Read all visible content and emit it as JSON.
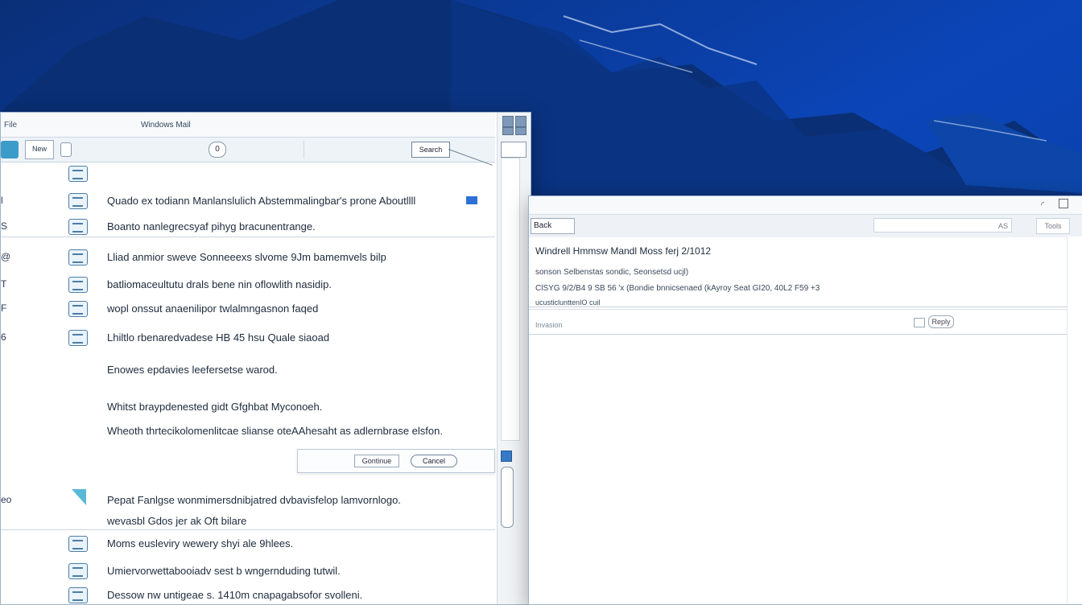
{
  "left_window": {
    "title_left": "File",
    "title_center": "Windows Mail",
    "toolbar": {
      "new_label": "New",
      "search_label": "0",
      "action_label": "Search"
    },
    "rows": [
      {
        "left": "",
        "text": ""
      },
      {
        "left": "l",
        "text": "Quado ex todiann Manlanslulich Abstemmalingbar's prone Aboutllll"
      },
      {
        "left": "S",
        "text": "Boanto nanlegrecsyaf pihyg bracunentrange."
      },
      {
        "left": "@",
        "text": "Lliad anmior sweve Sonneeexs slvome 9Jm bamemvels bilp"
      },
      {
        "left": "T",
        "text": "batliomaceultutu drals bene nin oflowlith nasidip."
      },
      {
        "left": "F",
        "text": "wopl onssut anaenilipor twlalmngasnon faqed"
      },
      {
        "left": "6",
        "text": "Lhiltlo rbenaredvadese HB 45 hsu Quale siaoad"
      },
      {
        "left": "",
        "text": "Enowes epdavies leefersetse warod."
      },
      {
        "left": "",
        "text": "Whitst braypdenested gidt Gfghbat Myconoeh."
      },
      {
        "left": "",
        "text": "Wheoth thrtecikolomenlitcae slianse oteAAhesaht as adlernbrase elsfon."
      },
      {
        "left": "eo",
        "text": "Pepat Fanlgse wonmimersdnibjatred dvbavisfelop lamvornlogo."
      },
      {
        "left": "",
        "text": "wevasbl Gdos jer ak Oft bilare"
      },
      {
        "left": "",
        "text": "Moms eusleviry wewery shyi ale 9hlees."
      },
      {
        "left": "",
        "text": "Umiervorwettabooiadv sest b wngernduding tutwil."
      },
      {
        "left": "",
        "text": "Dessow nw untigeae s. 1410m cnapagabsofor svolleni."
      }
    ],
    "popup": {
      "btn1": "Gontinue",
      "btn2": "Cancel"
    }
  },
  "right_window": {
    "back_label": "Back",
    "search_placeholder": "AS",
    "options_label": "Tools",
    "header": {
      "title": "Windrell Hmmsw Mandl Moss ferj 2/1012",
      "line1": "sonson Selbenstas sondic, Seonsetsd ucjl)",
      "line2": "ClSYG 9/2/B4 9 SB 56 'x (Bondie bnnicsenaed (kAyroy Seat GI20, 40L2 F59 +3",
      "line3": "ucusticlunttenIO cuil"
    },
    "subbar": {
      "label": "Invasion",
      "btn": "Reply"
    }
  }
}
